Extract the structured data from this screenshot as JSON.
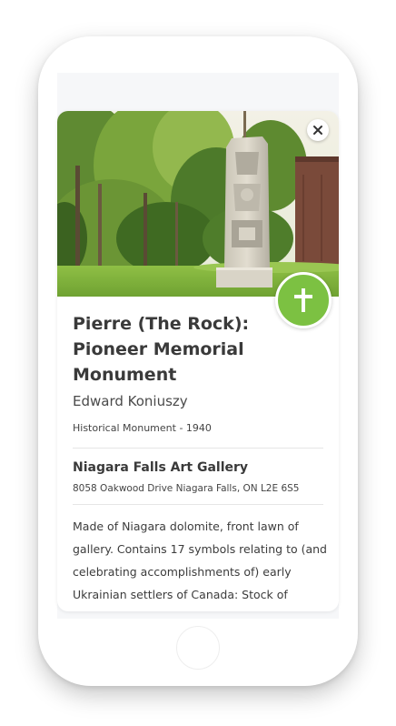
{
  "artwork": {
    "title": "Pierre (The Rock): Pioneer Memorial Monument",
    "artist": "Edward Koniuszy",
    "category_year": "Historical Monument - 1940",
    "badge_icon": "cross-icon",
    "badge_color": "#7cc142"
  },
  "venue": {
    "name": "Niagara Falls Art Gallery",
    "address": "8058 Oakwood Drive Niagara Falls, ON L2E 6S5"
  },
  "description": "Made of Niagara dolomite, front lawn of gallery. Contains 17 symbols relating to (and celebrating accomplishments of) early Ukrainian settlers of Canada: Stock of",
  "controls": {
    "close_icon": "close-icon"
  }
}
